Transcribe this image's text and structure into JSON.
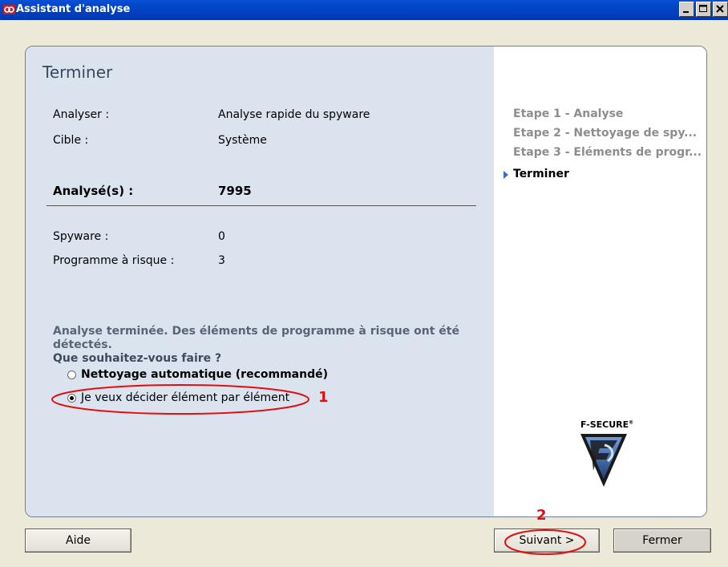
{
  "window": {
    "title": "Assistant d'analyse"
  },
  "panel": {
    "title": "Terminer",
    "summary": [
      {
        "label": "Analyser :",
        "value": "Analyse rapide du spyware"
      },
      {
        "label": "Cible :",
        "value": "Système"
      }
    ],
    "scanned": {
      "label": "Analysé(s) :",
      "value": "7995"
    },
    "results": [
      {
        "label": "Spyware :",
        "value": "0"
      },
      {
        "label": "Programme à risque :",
        "value": "3"
      }
    ],
    "message": "Analyse terminée. Des éléments de programme à risque ont été détectés.",
    "question": "Que souhaitez-vous faire ?",
    "options": [
      {
        "label": "Nettoyage automatique (recommandé)",
        "checked": false
      },
      {
        "label": "Je veux décider élément par élément",
        "checked": true
      }
    ]
  },
  "steps": [
    {
      "label": "Etape 1 - Analyse",
      "current": false
    },
    {
      "label": "Etape 2 - Nettoyage de spy...",
      "current": false
    },
    {
      "label": "Etape 3 - Eléments de progr...",
      "current": false
    },
    {
      "label": "Terminer",
      "current": true
    }
  ],
  "logo": {
    "text": "F-SECURE",
    "mark": "®"
  },
  "buttons": {
    "help": "Aide",
    "next": "Suivant >",
    "close": "Fermer"
  },
  "annotations": {
    "one": "1",
    "two": "2",
    "color": "#e01010"
  },
  "colors": {
    "titlebar": "#0045c7",
    "left_panel": "#dbe3ef",
    "step_current_arrow": "#3a6ec8"
  }
}
